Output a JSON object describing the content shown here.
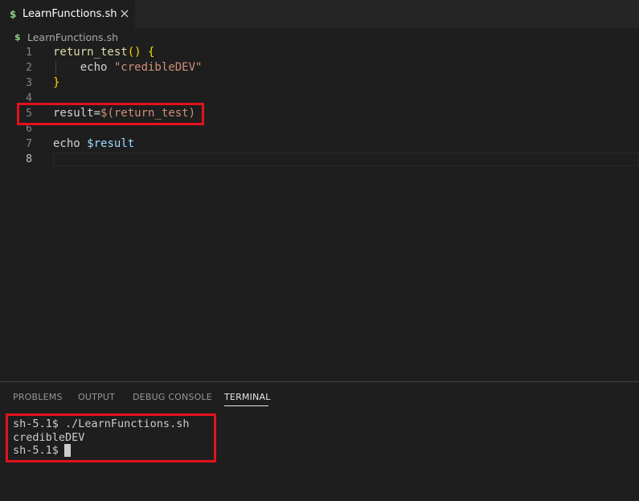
{
  "tab": {
    "icon": "shell-script-dollar-icon",
    "icon_glyph": "$",
    "label": "LearnFunctions.sh",
    "close_glyph": "×"
  },
  "breadcrumb": {
    "icon_glyph": "$",
    "label": "LearnFunctions.sh"
  },
  "editor": {
    "lines": [
      {
        "num": "1",
        "tokens": [
          [
            "fn",
            "return_test"
          ],
          [
            "brace",
            "() {"
          ]
        ]
      },
      {
        "num": "2",
        "tokens": [
          [
            "kw",
            "    echo "
          ],
          [
            "str",
            "\"credibleDEV\""
          ]
        ]
      },
      {
        "num": "3",
        "tokens": [
          [
            "brace",
            "}"
          ]
        ]
      },
      {
        "num": "4",
        "tokens": []
      },
      {
        "num": "5",
        "tokens": [
          [
            "kw",
            "result="
          ],
          [
            "sub",
            "$(return_test)"
          ]
        ]
      },
      {
        "num": "6",
        "tokens": []
      },
      {
        "num": "7",
        "tokens": [
          [
            "kw",
            "echo "
          ],
          [
            "var",
            "$result"
          ]
        ]
      },
      {
        "num": "8",
        "tokens": []
      }
    ],
    "active_line": "8"
  },
  "panel": {
    "tabs": [
      "PROBLEMS",
      "OUTPUT",
      "DEBUG CONSOLE",
      "TERMINAL"
    ],
    "active_tab": "TERMINAL"
  },
  "terminal": {
    "lines": [
      "sh-5.1$ ./LearnFunctions.sh",
      "credibleDEV",
      "sh-5.1$ "
    ]
  },
  "colors": {
    "highlight_box": "#e3121c",
    "background": "#1e1e1e"
  }
}
